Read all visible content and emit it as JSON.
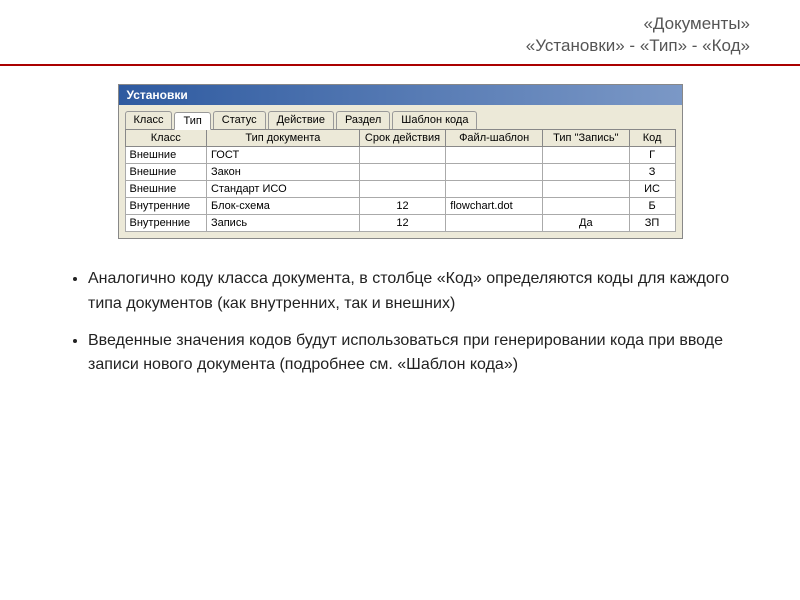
{
  "header": {
    "line1": "«Документы»",
    "line2": "«Установки» - «Тип» - «Код»"
  },
  "window": {
    "title": "Установки",
    "tabs": [
      "Класс",
      "Тип",
      "Статус",
      "Действие",
      "Раздел",
      "Шаблон кода"
    ],
    "active_tab_index": 1,
    "columns": [
      "Класс",
      "Тип документа",
      "Срок действия",
      "Файл-шаблон",
      "Тип \"Запись\"",
      "Код"
    ],
    "rows": [
      {
        "class": "Внешние",
        "type": "ГОСТ",
        "term": "",
        "file": "",
        "record": "",
        "code": "Г"
      },
      {
        "class": "Внешние",
        "type": "Закон",
        "term": "",
        "file": "",
        "record": "",
        "code": "З"
      },
      {
        "class": "Внешние",
        "type": "Стандарт ИСО",
        "term": "",
        "file": "",
        "record": "",
        "code": "ИС"
      },
      {
        "class": "Внутренние",
        "type": "Блок-схема",
        "term": "12",
        "file": "flowchart.dot",
        "record": "",
        "code": "Б"
      },
      {
        "class": "Внутренние",
        "type": "Запись",
        "term": "12",
        "file": "",
        "record": "Да",
        "code": "ЗП"
      }
    ]
  },
  "bullets": [
    "Аналогично коду класса документа, в столбце «Код» определяются коды для каждого типа документов (как внутренних, так и внешних)",
    "Введенные значения кодов будут использоваться при генерировании кода при вводе записи нового документа (подробнее см. «Шаблон кода»)"
  ]
}
